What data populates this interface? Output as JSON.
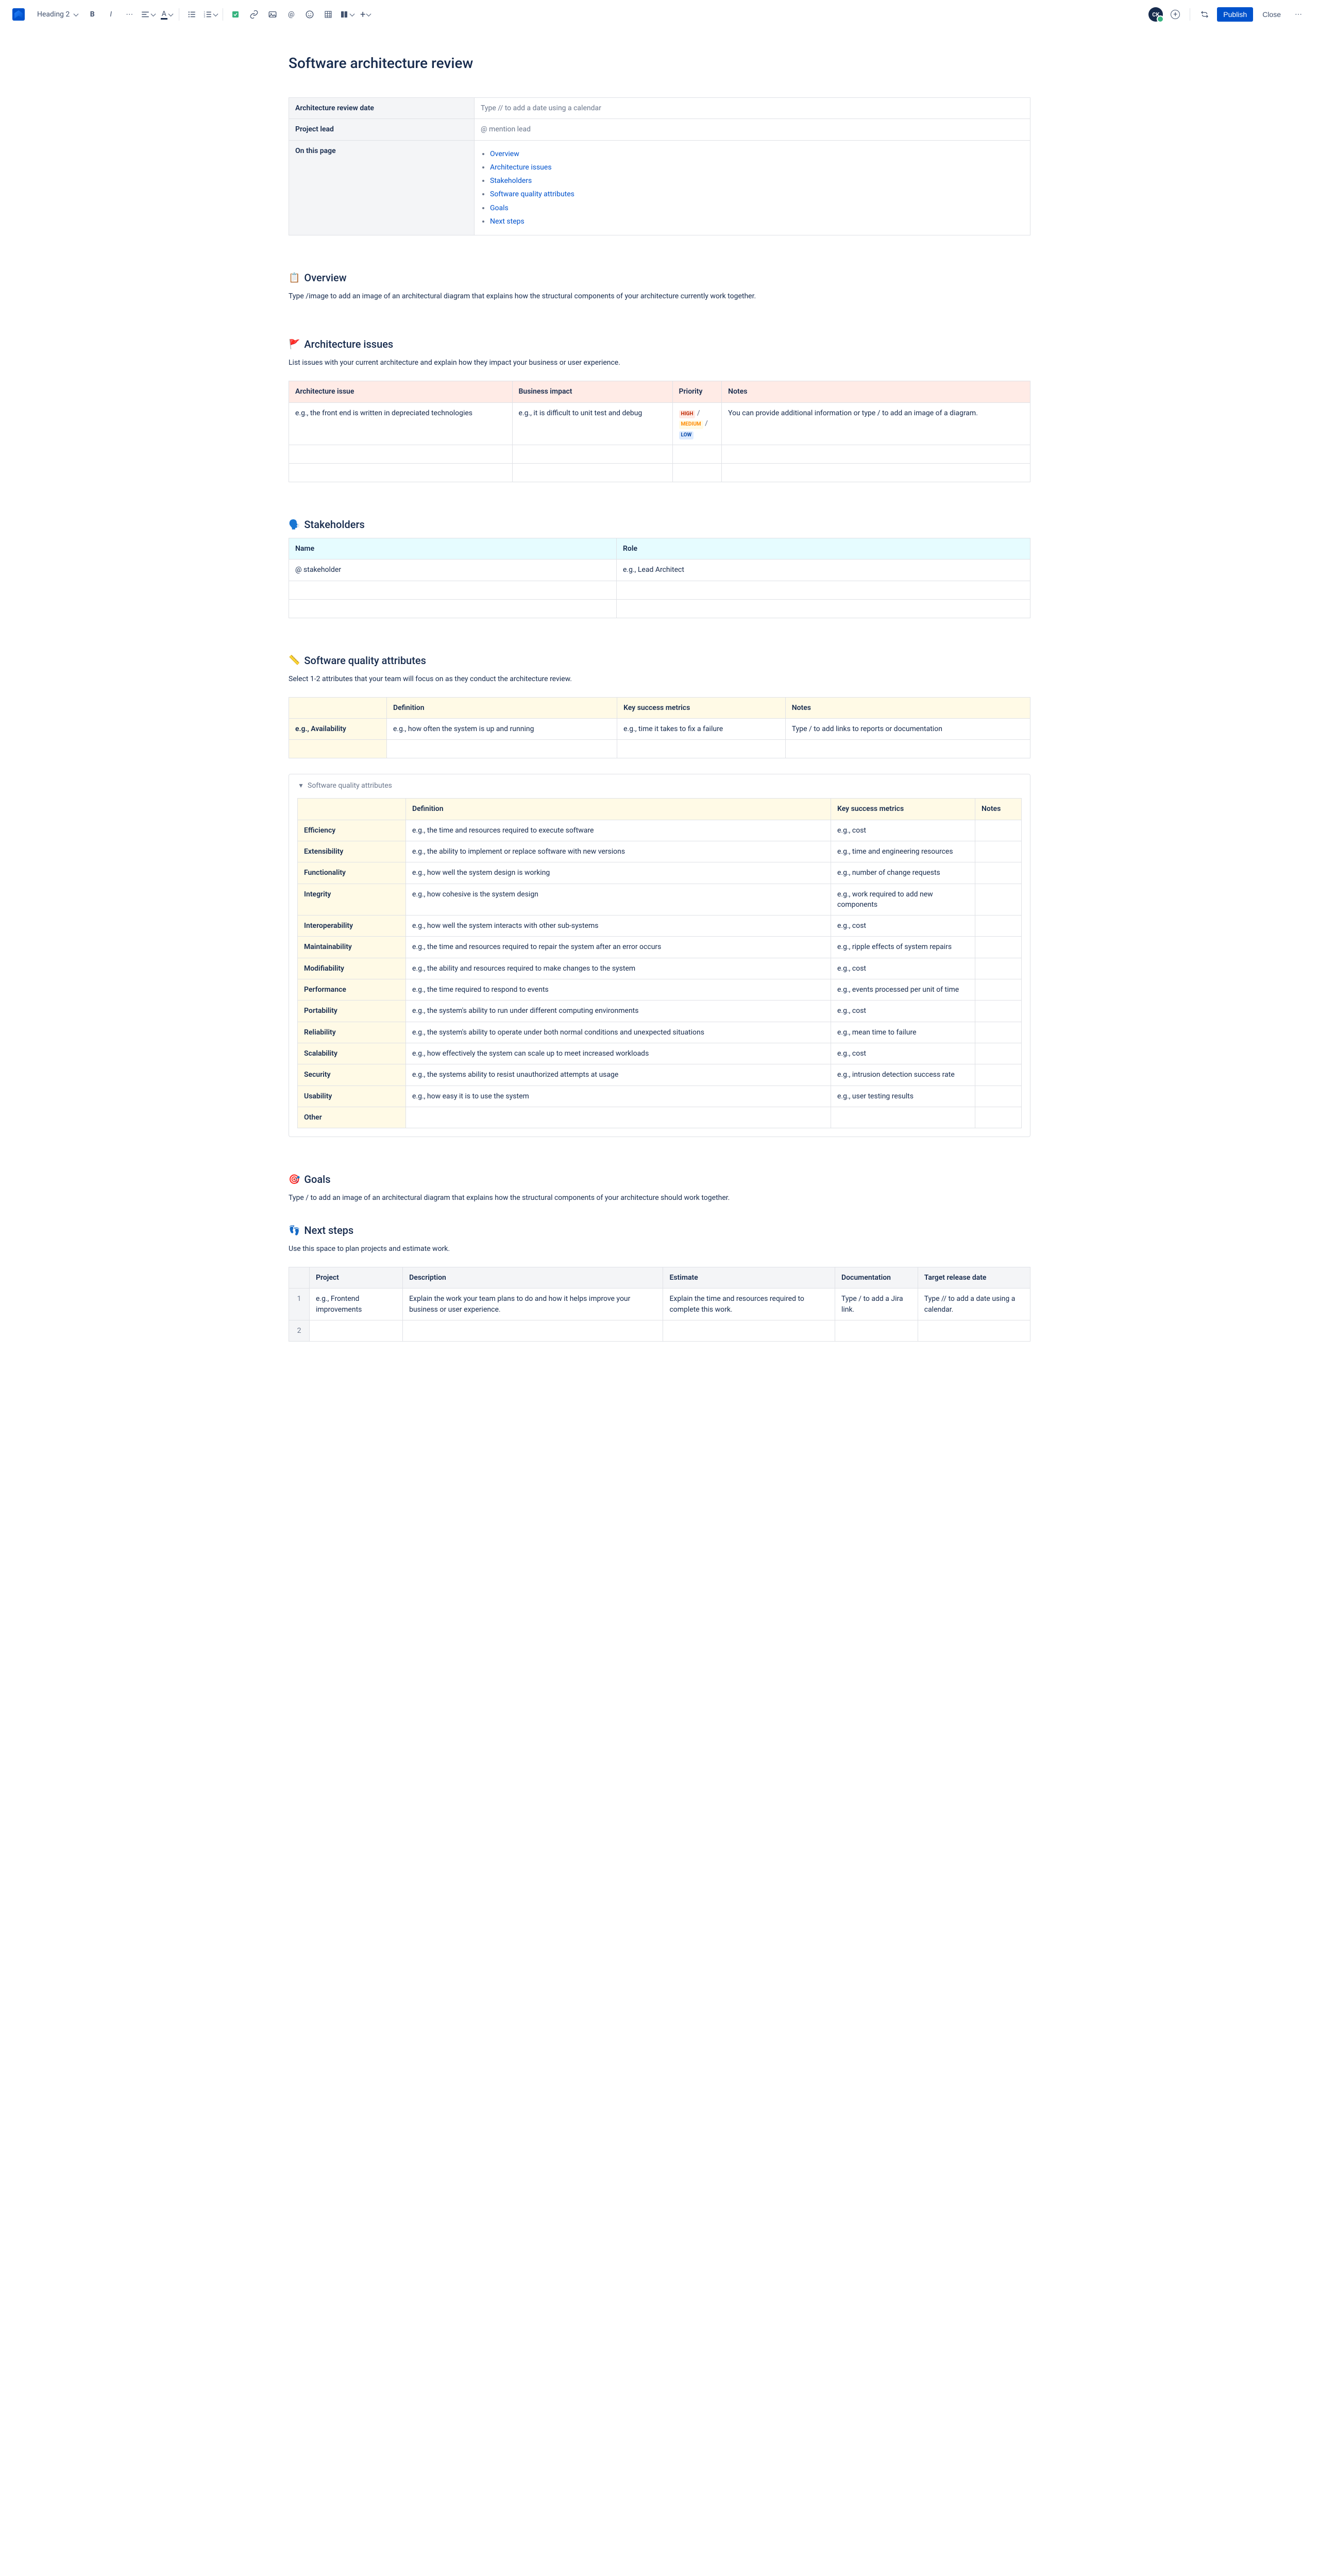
{
  "toolbar": {
    "heading_label": "Heading 2",
    "publish_label": "Publish",
    "close_label": "Close",
    "avatar_initials": "CK"
  },
  "title": "Software architecture review",
  "meta": {
    "rows": [
      {
        "label": "Architecture review date",
        "value": "Type // to add a date using a calendar"
      },
      {
        "label": "Project lead",
        "value": "@ mention lead"
      },
      {
        "label": "On this page",
        "value": ""
      }
    ],
    "toc": [
      "Overview",
      "Architecture issues",
      "Stakeholders",
      "Software quality attributes",
      "Goals",
      "Next steps"
    ]
  },
  "overview": {
    "emoji": "📋",
    "title": "Overview",
    "helper": "Type /image to add an image of an architectural diagram that explains how the structural components of your architecture currently work together."
  },
  "issues": {
    "emoji": "🚩",
    "title": "Architecture issues",
    "helper": "List issues with your current architecture and explain how they impact your business or user experience.",
    "columns": [
      "Architecture issue",
      "Business impact",
      "Priority",
      "Notes"
    ],
    "row": {
      "issue": "e.g., the front end is written in depreciated technologies",
      "impact": "e.g., it is difficult to unit test and debug",
      "priority_high": "HIGH",
      "priority_medium": "MEDIUM",
      "priority_low": "LOW",
      "notes": "You can provide additional information or type / to add an image of a diagram."
    }
  },
  "stakeholders": {
    "emoji": "🗣️",
    "title": "Stakeholders",
    "columns": [
      "Name",
      "Role"
    ],
    "row": {
      "name": "@ stakeholder",
      "role": "e.g., Lead Architect"
    }
  },
  "quality": {
    "emoji": "📏",
    "title": "Software quality attributes",
    "helper": "Select 1-2 attributes that your team will focus on as they conduct the architecture review.",
    "columns": [
      "",
      "Definition",
      "Key success metrics",
      "Notes"
    ],
    "row": {
      "name": "e.g., Availability",
      "definition": "e.g., how often the system is up and running",
      "metrics": "e.g., time it takes to fix a failure",
      "notes": "Type / to add links to reports or documentation"
    }
  },
  "quality_expand": {
    "label": "Software quality attributes",
    "columns": [
      "",
      "Definition",
      "Key success metrics",
      "Notes"
    ],
    "rows": [
      {
        "name": "Efficiency",
        "definition": "e.g., the time and resources required to execute software",
        "metrics": "e.g., cost"
      },
      {
        "name": "Extensibility",
        "definition": "e.g., the ability to implement or replace software with new versions",
        "metrics": "e.g., time and engineering resources"
      },
      {
        "name": "Functionality",
        "definition": "e.g., how well the system design is working",
        "metrics": "e.g., number of change requests"
      },
      {
        "name": "Integrity",
        "definition": "e.g., how cohesive is the system design",
        "metrics": "e.g., work required to add new components"
      },
      {
        "name": "Interoperability",
        "definition": "e.g., how well the system interacts with other sub-systems",
        "metrics": "e.g., cost"
      },
      {
        "name": "Maintainability",
        "definition": "e.g., the time and resources required to repair the system after an error occurs",
        "metrics": "e.g., ripple effects of system repairs"
      },
      {
        "name": "Modifiability",
        "definition": "e.g., the ability and resources required to make changes to the system",
        "metrics": "e.g., cost"
      },
      {
        "name": "Performance",
        "definition": "e.g., the time required to respond to events",
        "metrics": "e.g., events processed per unit of time"
      },
      {
        "name": "Portability",
        "definition": "e.g., the system's ability to run under different computing environments",
        "metrics": "e.g., cost"
      },
      {
        "name": "Reliability",
        "definition": "e.g., the system's ability to operate under both normal conditions and unexpected situations",
        "metrics": "e.g., mean time to failure"
      },
      {
        "name": "Scalability",
        "definition": "e.g., how effectively the system can scale up to meet increased workloads",
        "metrics": "e.g., cost"
      },
      {
        "name": "Security",
        "definition": "e.g., the systems ability to resist unauthorized attempts at usage",
        "metrics": "e.g., intrusion detection success rate"
      },
      {
        "name": "Usability",
        "definition": "e.g., how easy it is to use the system",
        "metrics": "e.g., user testing results"
      },
      {
        "name": "Other",
        "definition": "",
        "metrics": ""
      }
    ]
  },
  "goals": {
    "emoji": "🎯",
    "title": "Goals",
    "helper": "Type / to add an image of an architectural diagram that explains how the structural components of your architecture should work together."
  },
  "next": {
    "emoji": "👣",
    "title": "Next steps",
    "helper": "Use this space to plan projects and estimate work.",
    "columns": [
      "",
      "Project",
      "Description",
      "Estimate",
      "Documentation",
      "Target release date"
    ],
    "row": {
      "num": "1",
      "project": "e.g., Frontend improvements",
      "description": "Explain the work your team plans to do and how it helps improve your business or user experience.",
      "estimate": "Explain the time and resources required to complete this work.",
      "documentation": "Type / to add a Jira link.",
      "target": "Type // to add a date using a calendar."
    },
    "row2_num": "2"
  }
}
